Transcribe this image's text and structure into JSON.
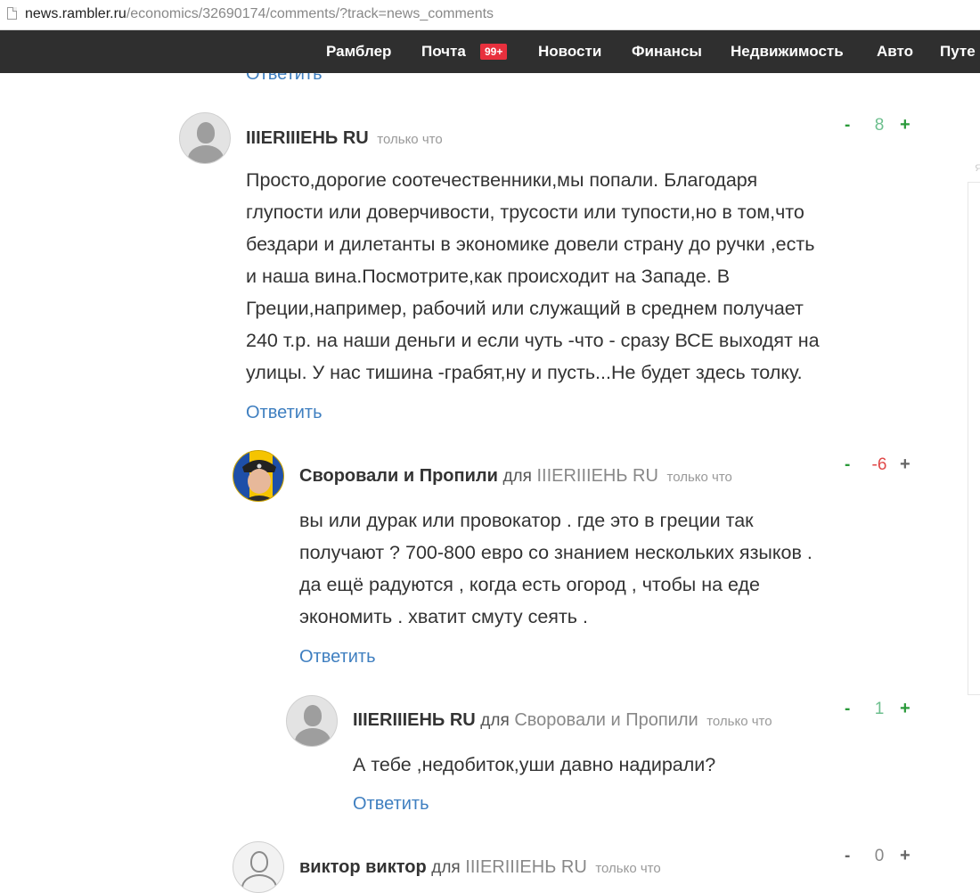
{
  "browser": {
    "url_host": "news.rambler.ru",
    "url_path": "/economics/32690174/comments/?track=news_comments"
  },
  "nav": {
    "items": [
      "Рамблер",
      "Почта",
      "Новости",
      "Финансы",
      "Недвижимость",
      "Авто",
      "Путе"
    ],
    "mail_badge": "99+"
  },
  "top_reply": "Ответить",
  "comments": [
    {
      "author": "IIIERIIIЕНЬ RU",
      "time": "только что",
      "text_lines": [
        "Просто,дорогие соотечественники,мы попали. Благодаря",
        "глупости или доверчивости, трусости или тупости,но в том,что",
        "бездари и дилетанты в экономике довели страну до ручки ,есть",
        "и наша вина.Посмотрите,как происходит на Западе. В",
        "Греции,например, рабочий или служащий в среднем получает",
        "240 т.р. на наши деньги и если чуть -что - сразу ВСЕ выходят на",
        "улицы. У нас тишина -грабят,ну и пусть...Не будет здесь толку."
      ],
      "reply": "Ответить",
      "vote": {
        "minus": "-",
        "score": "8",
        "plus": "+"
      }
    },
    {
      "author": "Своровали и Пропили",
      "for": "для",
      "target": "IIIERIIIЕНЬ RU",
      "time": "только что",
      "text_lines": [
        "вы или дурак или провокатор . где это в греции так",
        "получают ? 700-800 евро со знанием нескольких языков .",
        "да ещё радуются , когда есть огород , чтобы на еде",
        "экономить . хватит смуту сеять ."
      ],
      "reply": "Ответить",
      "vote": {
        "minus": "-",
        "score": "-6",
        "plus": "+"
      }
    },
    {
      "author": "IIIERIIIЕНЬ RU",
      "for": "для",
      "target": "Своровали и Пропили",
      "time": "только что",
      "text_lines": [
        "А тебе ,недобиток,уши давно надирали?"
      ],
      "reply": "Ответить",
      "vote": {
        "minus": "-",
        "score": "1",
        "plus": "+"
      }
    },
    {
      "author": "виктор виктор",
      "for": "для",
      "target": "IIIERIIIЕНЬ RU",
      "time": "только что",
      "vote": {
        "minus": "-",
        "score": "0",
        "plus": "+"
      }
    }
  ],
  "colors": {
    "nav_bg": "#2f2f2f",
    "badge": "#e8303d",
    "link": "#3f7fc0",
    "score_positive": "#6dbf8e",
    "score_negative": "#e04848",
    "score_neutral": "#888888",
    "plus_active": "#2a9a3a"
  }
}
